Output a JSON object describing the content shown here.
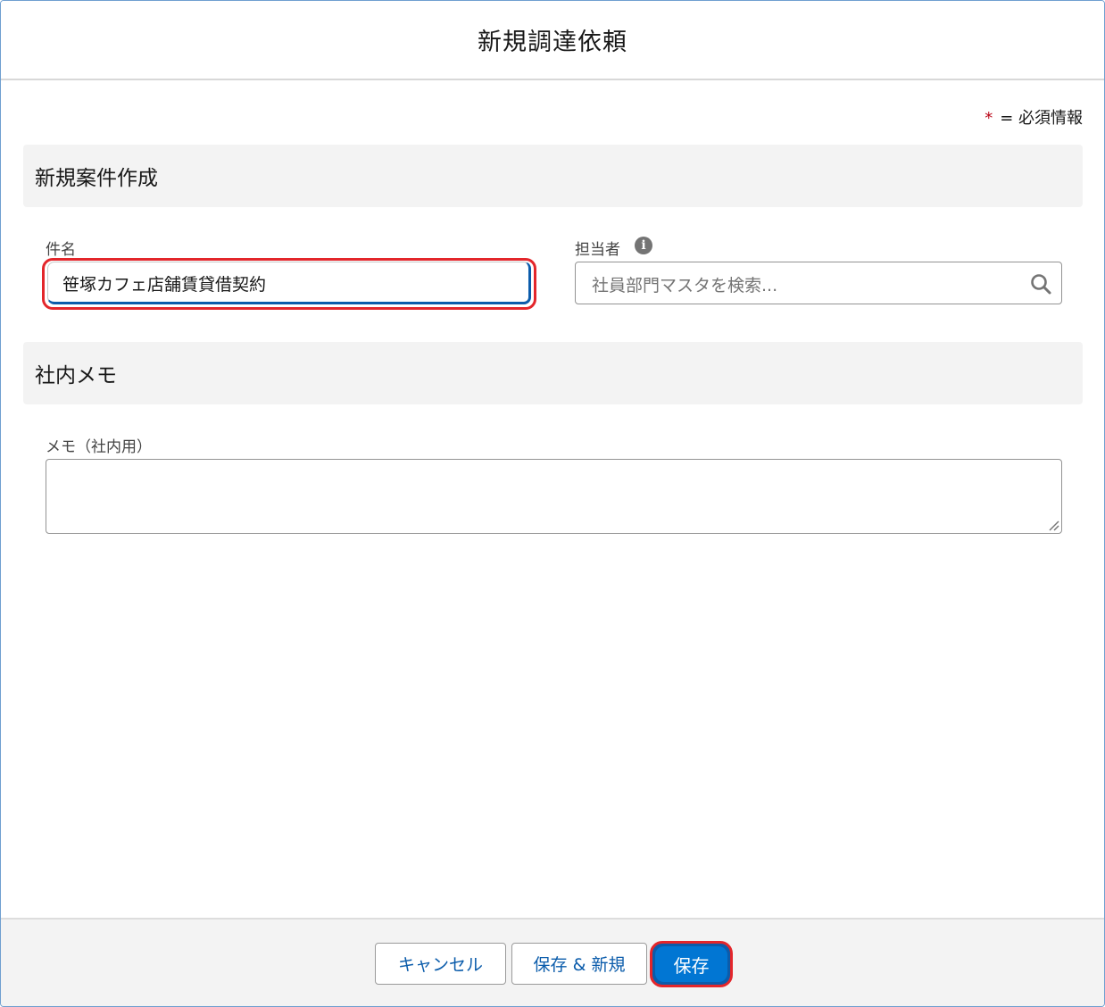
{
  "modal": {
    "title": "新規調達依頼"
  },
  "required_note": {
    "star": "*",
    "text": "= 必須情報"
  },
  "sections": {
    "new_case": "新規案件作成",
    "internal_memo": "社内メモ"
  },
  "fields": {
    "subject": {
      "label": "件名",
      "value": "笹塚カフェ店舗賃貸借契約"
    },
    "assignee": {
      "label": "担当者",
      "info_icon": "info-icon",
      "placeholder": "社員部門マスタを検索...",
      "icon": "search-icon"
    },
    "memo": {
      "label": "メモ（社内用）",
      "value": ""
    }
  },
  "footer": {
    "cancel_label": "キャンセル",
    "save_new_label": "保存 & 新規",
    "save_label": "保存"
  },
  "colors": {
    "brand": "#0176d3",
    "link": "#0b5cab",
    "required": "#ba0517",
    "highlight": "#e3262b",
    "section_bg": "#f3f3f3"
  }
}
